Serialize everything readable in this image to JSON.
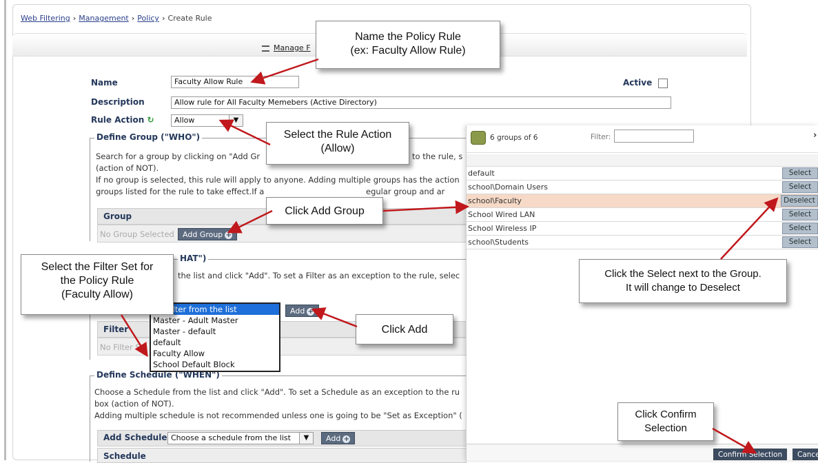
{
  "breadcrumb": [
    "Web Filtering",
    "Management",
    "Policy",
    "Create Rule"
  ],
  "breadcrumb_sep": "›",
  "toolbar": {
    "manage_label": "Manage F"
  },
  "form": {
    "name_label": "Name",
    "name_value": "Faculty Allow Rule",
    "active_label": "Active",
    "description_label": "Description",
    "description_value": "Allow rule for All Faculty Memebers (Active Directory)",
    "rule_action_label": "Rule Action",
    "rule_action_value": "Allow"
  },
  "define_group": {
    "legend": "Define Group (\"WHO\")",
    "line1a": "Search for a group by clicking on \"Add Gr",
    "line1b": "to the rule, s",
    "line2": "(action of NOT).",
    "line3": "If no group is selected, this rule will apply to anyone. Adding multiple groups has the action",
    "line4a": "groups listed for the rule to take effect.If a",
    "line4b": "egular group and ar",
    "column_header": "Group",
    "empty_text": "No Group Selected",
    "add_button": "Add Group"
  },
  "define_filter": {
    "legend_partial": "HAT\")",
    "line1": "the list and click \"Add\". To set a Filter as an exception to the rule, selec",
    "add_button": "Add",
    "column_header": "Filter",
    "empty_text": "No Filter S",
    "dropdown_options": [
      "e a filter from the list",
      "Master - Adult Master",
      "Master - default",
      "default",
      "Faculty Allow",
      "School Default Block"
    ]
  },
  "define_schedule": {
    "legend": "Define Schedule (\"WHEN\")",
    "line1": "Choose a Schedule from the list and click \"Add\". To set a Schedule as an exception to the ru",
    "line2": "box (action of NOT).",
    "line3": "Adding multiple schedule is not recommended unless one is going to be \"Set as Exception\" (",
    "add_label": "Add Schedule",
    "select_value": "Choose a schedule from the list",
    "add_button": "Add",
    "column_header": "Schedule"
  },
  "group_picker": {
    "count_text": "6 groups of 6",
    "filter_label": "Filter:",
    "close_glyph": "›",
    "groups": [
      {
        "name": "default",
        "action": "Select"
      },
      {
        "name": "school\\Domain Users",
        "action": "Select"
      },
      {
        "name": "school\\Faculty",
        "action": "Deselect",
        "selected": true
      },
      {
        "name": "School Wired LAN",
        "action": "Select"
      },
      {
        "name": "School Wireless IP",
        "action": "Select"
      },
      {
        "name": "school\\Students",
        "action": "Select"
      }
    ],
    "confirm_button": "Confirm Selection",
    "cancel_button": "Cance"
  },
  "callouts": {
    "name": [
      "Name the Policy Rule",
      "(ex: Faculty Allow Rule)"
    ],
    "action": [
      "Select the Rule Action",
      "(Allow)"
    ],
    "add_group": [
      "Click Add Group"
    ],
    "filter_set": [
      "Select the Filter Set for",
      "the Policy Rule",
      "(Faculty Allow)"
    ],
    "add": [
      "Click Add"
    ],
    "select_group": [
      "Click the Select next to the Group.",
      "It will change to Deselect"
    ],
    "confirm": [
      "Click Confirm",
      "Selection"
    ]
  },
  "colors": {
    "label": "#23375a",
    "arrow": "#c0181c",
    "selected_row": "#f6d9c7",
    "button": "#5c6b7f"
  }
}
